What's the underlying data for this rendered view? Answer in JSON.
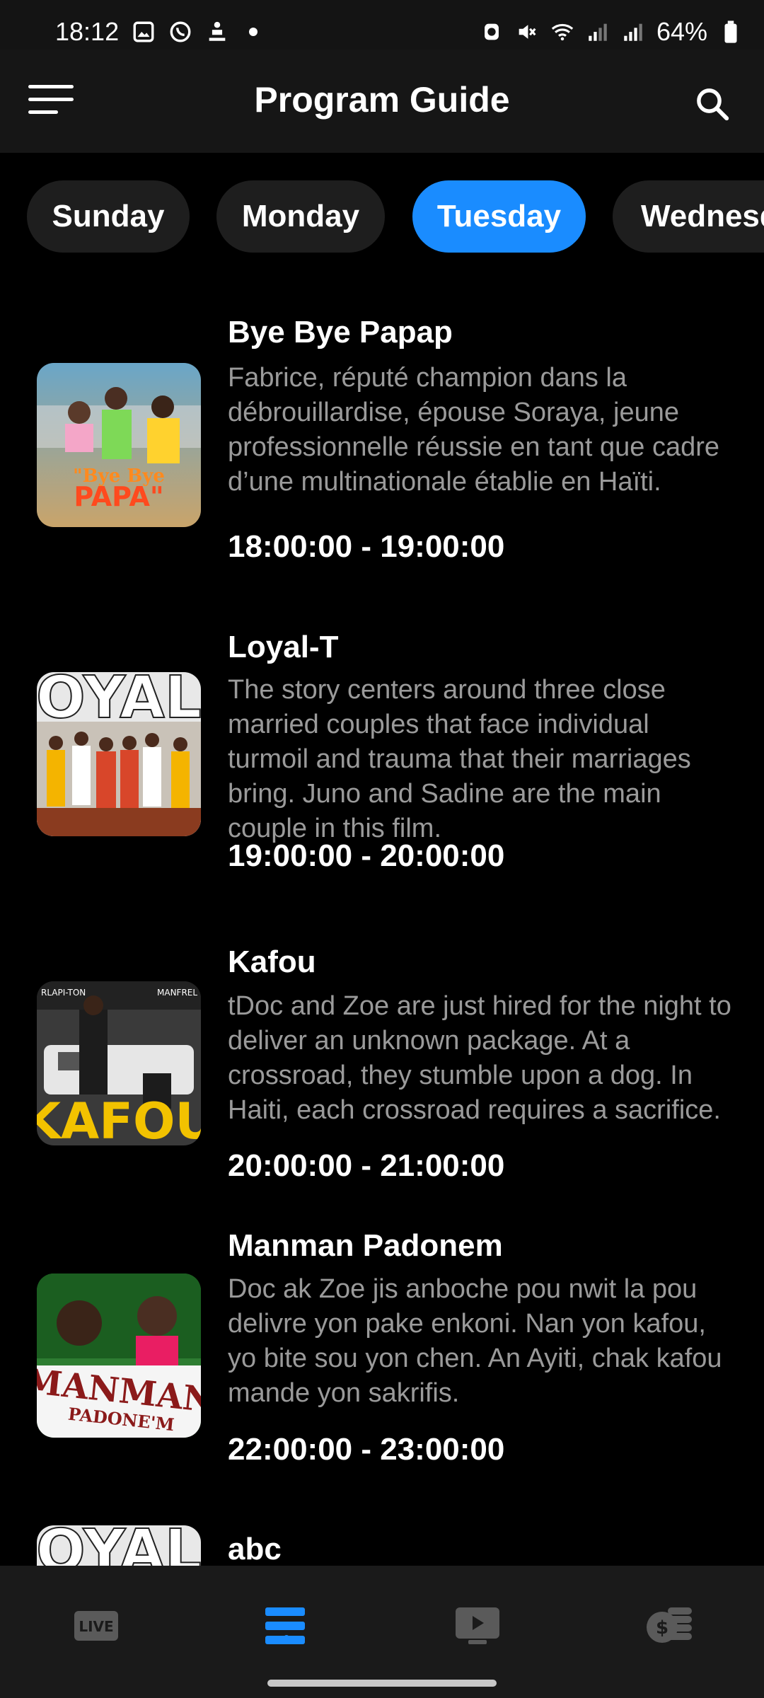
{
  "status_bar": {
    "time": "18:12",
    "battery": "64%"
  },
  "app_bar": {
    "title": "Program Guide"
  },
  "days": [
    "Sunday",
    "Monday",
    "Tuesday",
    "Wednesday"
  ],
  "active_day": "Tuesday",
  "programs": [
    {
      "title": "Bye Bye Papap",
      "description": "Fabrice, réputé champion dans la débrouillardise, épouse Soraya, jeune professionnelle réussie en tant que cadre d’une multinationale établie en Haïti.",
      "time": "18:00:00 - 19:00:00",
      "poster_text": "Bye Bye PAPA"
    },
    {
      "title": "Loyal-T",
      "description": "The story centers around three close married couples that face individual turmoil and trauma that their marriages bring. Juno and Sadine are the main couple in this film.",
      "time": "19:00:00 - 20:00:00",
      "poster_text": "OYAL"
    },
    {
      "title": "Kafou",
      "description": "tDoc and Zoe are just hired for the night to deliver an unknown package. At a crossroad, they stumble upon a dog. In Haiti, each crossroad requires a sacrifice.",
      "time": "20:00:00 - 21:00:00",
      "poster_text": "KAFOU"
    },
    {
      "title": "Manman Padonem",
      "description": "Doc ak Zoe jis anboche pou nwit la pou delivre yon pake enkoni. Nan yon kafou, yo bite sou yon chen. An Ayiti, chak kafou mande yon sakrifis.",
      "time": "22:00:00 - 23:00:00",
      "poster_text": "MANMAN PADONE'M"
    },
    {
      "title": "abc",
      "description": "",
      "time": "",
      "poster_text": "OYAL"
    }
  ],
  "bottom_nav": {
    "live_label": "LIVE",
    "active": "guide"
  },
  "colors": {
    "accent": "#1a8cff",
    "background": "#000000",
    "description_text": "#9a9a9a"
  }
}
